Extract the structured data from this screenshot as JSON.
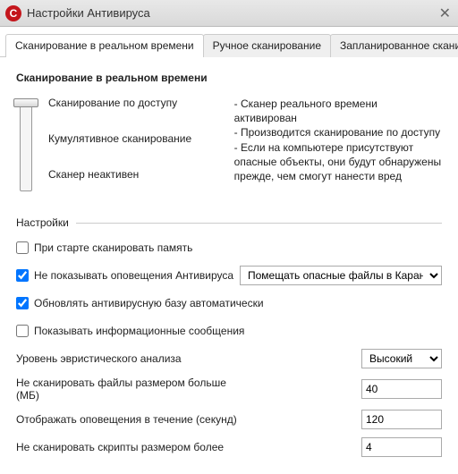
{
  "window": {
    "title": "Настройки Антивируса",
    "app_icon_letter": "C",
    "close_glyph": "✕"
  },
  "tabs": {
    "items": [
      {
        "label": "Сканирование в реальном времени",
        "active": true
      },
      {
        "label": "Ручное сканирование",
        "active": false
      },
      {
        "label": "Запланированное сканиров",
        "active": false
      }
    ],
    "arrow_left": "◄",
    "arrow_right": "►"
  },
  "realtime": {
    "heading": "Сканирование в реальном времени",
    "slider_levels": [
      "Сканирование по доступу",
      "Кумулятивное сканирование",
      "Сканер неактивен"
    ],
    "description": [
      "- Сканер реального времени активирован",
      "- Производится сканирование по доступу",
      "- Если на компьютере присутствуют опасные объекты, они будут обнаружены прежде, чем смогут нанести вред"
    ]
  },
  "settings": {
    "section_label": "Настройки",
    "rows": {
      "scan_memory_on_start": {
        "label": "При старте сканировать память",
        "checked": false
      },
      "hide_alerts": {
        "label": "Не показывать оповещения Антивируса",
        "checked": true,
        "select_value": "Помещать опасные файлы в Карантин",
        "options": [
          "Помещать опасные файлы в Карантин"
        ]
      },
      "auto_update_db": {
        "label": "Обновлять антивирусную базу автоматически",
        "checked": true
      },
      "show_info_msgs": {
        "label": "Показывать информационные сообщения",
        "checked": false
      },
      "heuristic_level": {
        "label": "Уровень эвристического анализа",
        "value": "Высокий",
        "options": [
          "Высокий"
        ]
      },
      "max_file_size": {
        "label": "Не сканировать файлы размером больше (МБ)",
        "value": "40"
      },
      "alert_duration": {
        "label": "Отображать оповещения в течение (секунд)",
        "value": "120"
      },
      "max_script_size": {
        "label": "Не сканировать скрипты размером более",
        "value": "4"
      }
    }
  }
}
